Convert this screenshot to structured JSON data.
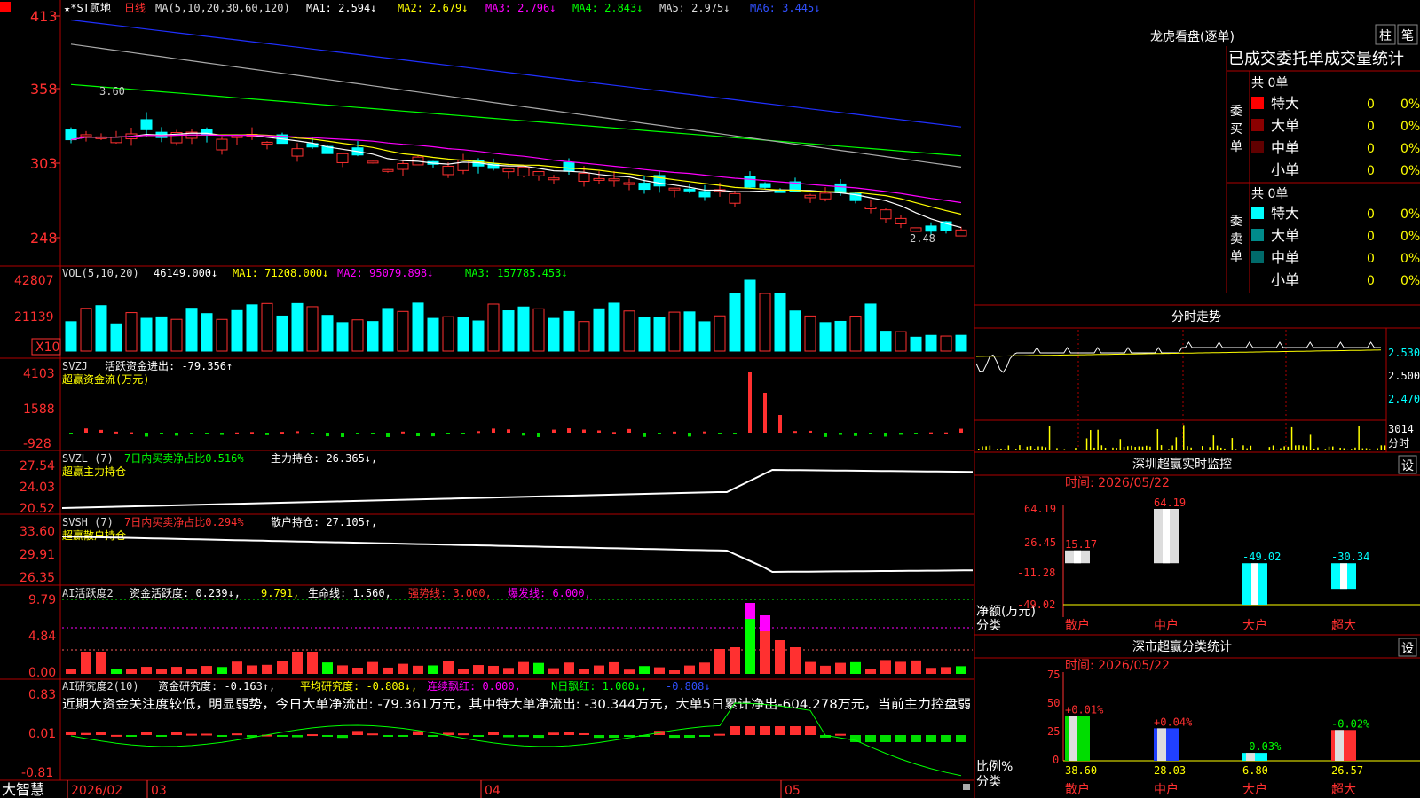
{
  "colors": {
    "up": "#ff3030",
    "down": "#00ffff",
    "grid": "#b00000",
    "bg": "#000000"
  },
  "header": {
    "title": "★*ST顾地",
    "period": "日线",
    "ma_label": "MA(5,10,20,30,60,120)",
    "ma1": "MA1: 2.594↓",
    "ma2": "MA2: 2.679↓",
    "ma3": "MA3: 2.796↓",
    "ma4": "MA4: 2.843↓",
    "ma5": "MA5: 2.975↓",
    "ma6": "MA6: 3.445↓"
  },
  "price_axis": [
    "413",
    "358",
    "303",
    "248"
  ],
  "price_annotations": {
    "high": "3.60",
    "low": "2.48"
  },
  "volume": {
    "label": "VOL(5,10,20)",
    "value": "46149.000↓",
    "ma1": "MA1: 71208.000↓",
    "ma2": "MA2: 95079.898↓",
    "ma3": "MA3: 157785.453↓",
    "axis": [
      "42807",
      "21139"
    ],
    "unit": "X10"
  },
  "svzj": {
    "label": "SVZJ",
    "desc": "活跃资金进出: -79.356↑",
    "sub": "超赢资金流(万元)",
    "axis": [
      "4103",
      "1588",
      "-928"
    ]
  },
  "svzl": {
    "label": "SVZL (7)",
    "ratio": "7日内买卖净占比0.516%",
    "hold": "主力持仓: 26.365↓,",
    "sub": "超赢主力持仓",
    "axis": [
      "27.54",
      "24.03",
      "20.52"
    ]
  },
  "svsh": {
    "label": "SVSH (7)",
    "ratio": "7日内买卖净占比0.294%",
    "hold": "散户持仓: 27.105↑,",
    "sub": "超赢散户持仓",
    "axis": [
      "33.60",
      "29.91",
      "26.35"
    ]
  },
  "ai1": {
    "label": "AI活跃度2",
    "v1": "资金活跃度: 0.239↓,",
    "v2": "9.791,",
    "v3": "生命线: 1.560,",
    "v4": "强势线: 3.000,",
    "v5": "爆发线: 6.000,",
    "axis": [
      "9.79",
      "4.84",
      "0.00"
    ]
  },
  "ai2": {
    "label": "AI研究度2(10)",
    "v1": "资金研究度: -0.163↑,",
    "v2": "平均研究度: -0.808↓,",
    "v3": "连续飘红: 0.000,",
    "v4": "N日飘红: 1.000↓,",
    "v5": "-0.808↓",
    "comment": "近期大资金关注度较低，明显弱势，今日大单净流出: -79.361万元，其中特大单净流出: -30.344万元，大单5日累计净出-604.278万元，当前主力控盘弱",
    "axis": [
      "0.83",
      "0.01",
      "-0.81"
    ]
  },
  "bottom": {
    "brand": "大智慧",
    "dates": [
      "2026/02",
      "03",
      "04",
      "05"
    ]
  },
  "longhu": {
    "title": "龙虎看盘(逐单)",
    "btn1": "柱",
    "btn2": "笔",
    "header": "已成交委托单成交量统计",
    "buy_label": "委买单",
    "sell_label": "委卖单",
    "buy_total": "共 0单",
    "sell_total": "共 0单",
    "buy_rows": [
      {
        "name": "特大",
        "count": "0",
        "pct": "0%",
        "color": "#ff0000"
      },
      {
        "name": "大单",
        "count": "0",
        "pct": "0%",
        "color": "#8b0000"
      },
      {
        "name": "中单",
        "count": "0",
        "pct": "0%",
        "color": "#600000"
      },
      {
        "name": "小单",
        "count": "0",
        "pct": "0%",
        "color": "#000000"
      }
    ],
    "sell_rows": [
      {
        "name": "特大",
        "count": "0",
        "pct": "0%",
        "color": "#00ffff"
      },
      {
        "name": "大单",
        "count": "0",
        "pct": "0%",
        "color": "#008b8b"
      },
      {
        "name": "中单",
        "count": "0",
        "pct": "0%",
        "color": "#006a6a"
      },
      {
        "name": "小单",
        "count": "0",
        "pct": "0%",
        "color": "#000000"
      }
    ]
  },
  "intraday": {
    "title": "分时走势",
    "axis": [
      "2.530",
      "2.500",
      "2.470"
    ],
    "vol_top": "3014",
    "vol_unit": "分时"
  },
  "sz_monitor": {
    "title": "深圳超赢实时监控",
    "btn": "设",
    "time": "时间: 2026/05/22",
    "axis": [
      "64.19",
      "26.45",
      "-11.28",
      "-49.02"
    ],
    "ylabel": "净额(万元)",
    "xlabel": "分类",
    "unit": "万元"
  },
  "sz_classify": {
    "title": "深市超赢分类统计",
    "btn": "设",
    "time": "时间: 2026/05/22",
    "axis": [
      "75",
      "50",
      "25",
      "0"
    ],
    "ylabel": "比例%",
    "xlabel": "分类"
  },
  "chart_data": [
    {
      "type": "bar",
      "title": "深圳超赢实时监控",
      "ylabel": "净额(万元)",
      "xlabel": "分类",
      "categories": [
        "散户",
        "中户",
        "大户",
        "超大"
      ],
      "values": [
        15.17,
        64.19,
        -49.02,
        -30.34
      ],
      "value_labels": [
        "15.17",
        "64.19",
        "-49.02",
        "-30.34"
      ],
      "ylim": [
        -49.02,
        64.19
      ]
    },
    {
      "type": "bar",
      "title": "深市超赢分类统计",
      "ylabel": "比例%",
      "xlabel": "分类",
      "categories": [
        "散户",
        "中户",
        "大户",
        "超大"
      ],
      "values": [
        38.6,
        28.03,
        6.8,
        26.57
      ],
      "value_labels": [
        "38.60",
        "28.03",
        "6.80",
        "26.57"
      ],
      "change_labels": [
        "+0.01%",
        "+0.04%",
        "-0.03%",
        "-0.02%"
      ],
      "ylim": [
        0,
        75
      ]
    }
  ]
}
